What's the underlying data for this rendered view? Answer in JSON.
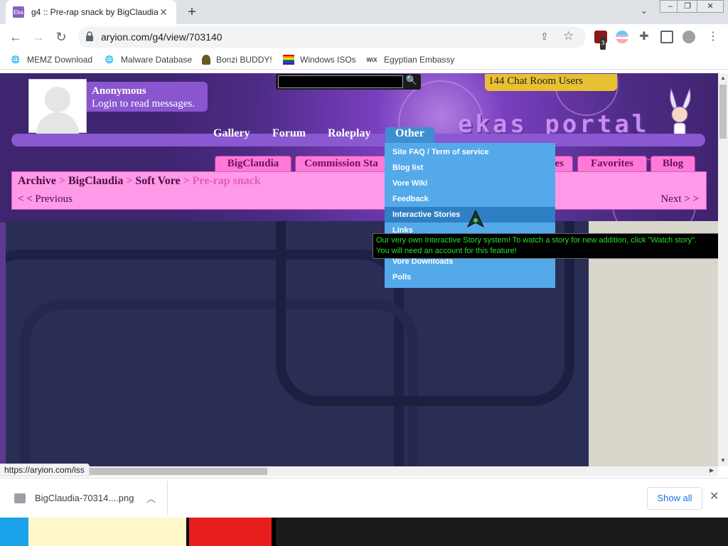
{
  "tab": {
    "title": "g4 :: Pre-rap snack by BigClaudia",
    "favicon_text": "Eka"
  },
  "toolbar": {
    "url": "aryion.com/g4/view/703140",
    "ext_badge": "3"
  },
  "bookmarks": [
    {
      "label": "MEMZ Download"
    },
    {
      "label": "Malware Database"
    },
    {
      "label": "Bonzi BUDDY!"
    },
    {
      "label": "Windows ISOs"
    },
    {
      "label": "Egyptian Embassy",
      "icon_text": "WiX"
    }
  ],
  "header": {
    "username": "Anonymous",
    "login_prompt": "Login to read messages.",
    "chat_users": "144 Chat Room Users",
    "logo_text": "ekas portal"
  },
  "nav": [
    "Gallery",
    "Forum",
    "Roleplay",
    "Other"
  ],
  "profile_tabs": [
    "BigClaudia",
    "Commission Sta",
    "es",
    "Favorites",
    "Blog"
  ],
  "breadcrumb": {
    "items": [
      "Archive",
      "BigClaudia",
      "Soft Vore"
    ],
    "separator": ">",
    "current": "Pre-rap snack",
    "previous": "< < Previous",
    "next": "Next > >"
  },
  "dropdown": {
    "items": [
      "Site FAQ / Term of service",
      "Blog list",
      "Vore Wiki",
      "Feedback",
      "Interactive Stories",
      "Links",
      "",
      "Vore Downloads",
      "Polls"
    ],
    "hover_index": 4
  },
  "tooltip": {
    "line1": "Our very own Interactive Story system! To watch a story for new addition, click \"Watch story\".",
    "line2": "You will need an account for this feature!"
  },
  "status_url": "https://aryion.com/iss",
  "downloads": {
    "filename": "BigClaudia-70314....png",
    "show_all": "Show all"
  },
  "colors": {
    "page_purple": "#5d3a91",
    "nav_active": "#3d8fd0",
    "dropdown": "#54a9ea",
    "tab_pink": "#ff7ad8",
    "tooltip_text": "#28e028",
    "chat_gold": "#e8c034"
  }
}
